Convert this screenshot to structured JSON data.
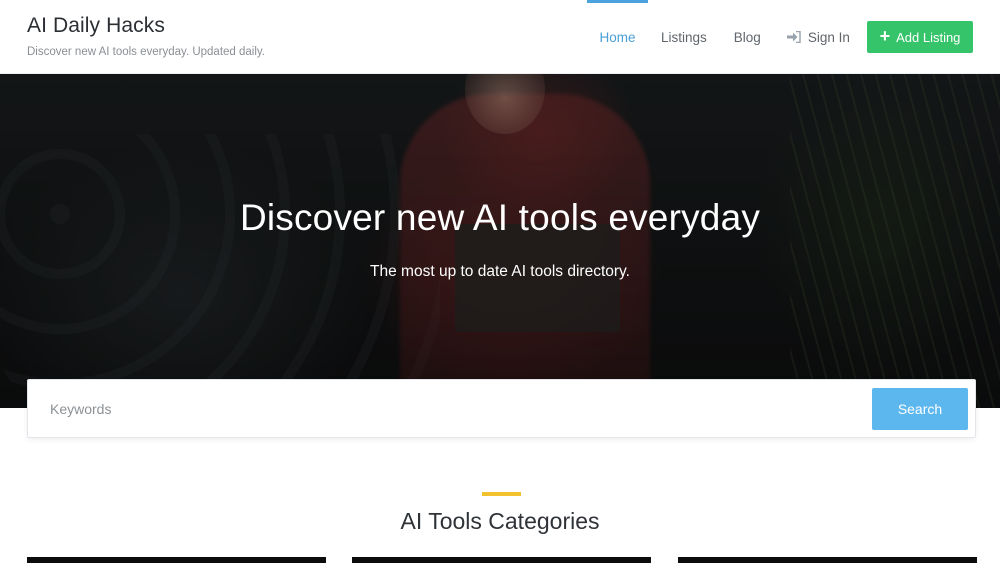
{
  "brand": {
    "title": "AI Daily Hacks",
    "tagline": "Discover new AI tools everyday. Updated daily."
  },
  "nav": {
    "items": [
      {
        "label": "Home",
        "active": true
      },
      {
        "label": "Listings",
        "active": false
      },
      {
        "label": "Blog",
        "active": false
      },
      {
        "label": "Sign In",
        "icon": "sign-in-icon",
        "active": false
      }
    ],
    "add_listing": {
      "label": "Add Listing",
      "icon": "plus-icon"
    }
  },
  "hero": {
    "title": "Discover new AI tools everyday",
    "subtitle": "The most up to date AI tools directory."
  },
  "search": {
    "placeholder": "Keywords",
    "value": "",
    "button_label": "Search"
  },
  "categories": {
    "title": "AI Tools Categories"
  },
  "colors": {
    "accent_blue": "#4aa3df",
    "search_button": "#5db7ef",
    "add_listing_green": "#35c46a",
    "section_accent": "#f2c12e"
  }
}
